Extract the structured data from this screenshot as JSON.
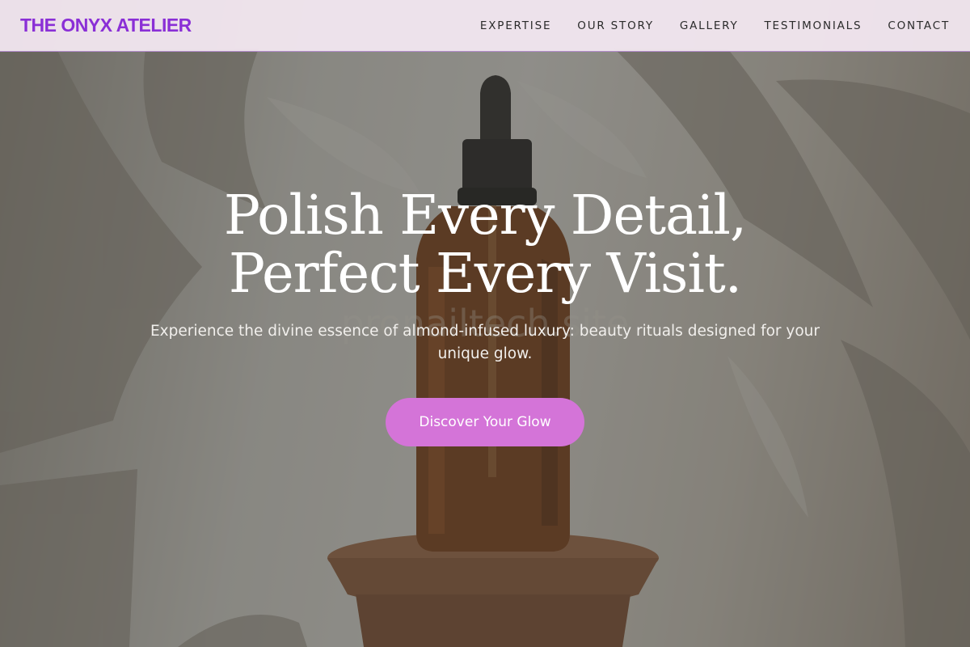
{
  "navbar": {
    "brand": "THE ONYX ATELIER",
    "links": [
      {
        "label": "EXPERTISE"
      },
      {
        "label": "OUR STORY"
      },
      {
        "label": "GALLERY"
      },
      {
        "label": "TESTIMONIALS"
      },
      {
        "label": "CONTACT"
      }
    ]
  },
  "hero": {
    "title_line_1": "Polish Every Detail,",
    "title_line_2": "Perfect Every Visit.",
    "subtitle": "Experience the divine essence of almond-infused luxury: beauty rituals designed for your unique glow.",
    "cta_label": "Discover Your Glow",
    "watermark": "pronailtech.site"
  },
  "colors": {
    "brand": "#8a2fd6",
    "cta": "#d474d8",
    "nav_background": "#f3e8f1",
    "nav_border": "#b38ccc"
  }
}
